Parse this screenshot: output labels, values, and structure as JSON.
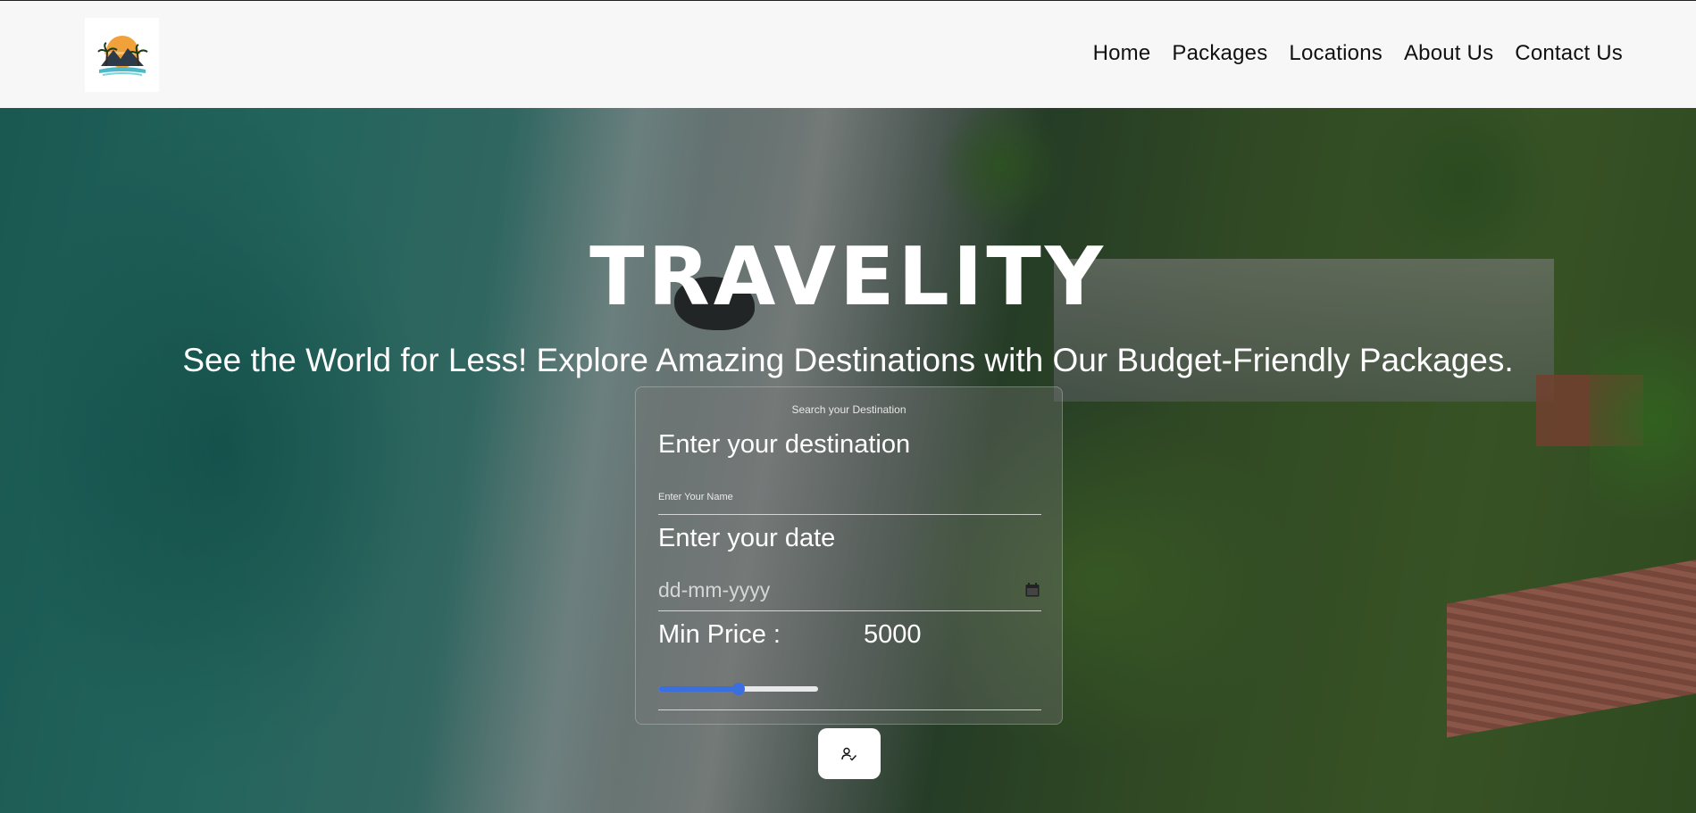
{
  "nav": {
    "logo_icon": "palm-mountain-sunset-logo",
    "links": [
      "Home",
      "Packages",
      "Locations",
      "About Us",
      "Contact Us"
    ]
  },
  "hero": {
    "title": "TRAVELITY",
    "subtitle": "See the World for Less! Explore Amazing Destinations with Our Budget-Friendly Packages."
  },
  "form": {
    "heading": "Search your Destination",
    "destination_placeholder": "Enter your destination",
    "name_label": "Enter Your Name",
    "date_label": "Enter your date",
    "date_placeholder": "dd-mm-yyyy",
    "date_icon": "calendar-icon",
    "price_label": "Min Price :",
    "price_value": "5000",
    "slider_fraction": 0.5,
    "submit_icon": "person-check-icon"
  },
  "colors": {
    "accent": "#3a6fe0",
    "navbar_bg": "#f7f7f7"
  }
}
